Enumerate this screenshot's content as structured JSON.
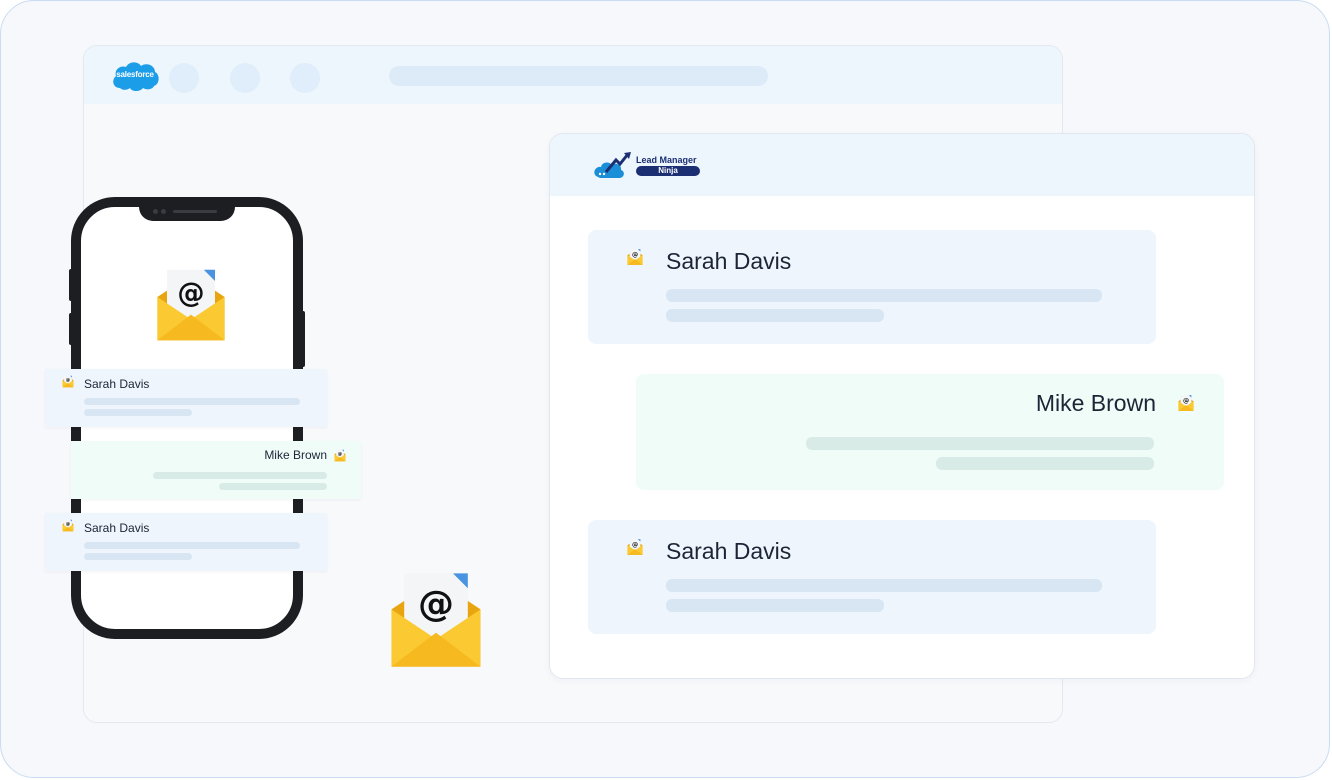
{
  "salesforce": {
    "logo_text": "salesforce",
    "brand_color": "#1c9de8"
  },
  "lead_manager": {
    "logo_line1": "Lead Manager",
    "logo_line2": "Ninja",
    "brand_color": "#1c2f73"
  },
  "desktop_messages": [
    {
      "name": "Sarah Davis",
      "style": "incoming"
    },
    {
      "name": "Mike Brown",
      "style": "outgoing"
    },
    {
      "name": "Sarah Davis",
      "style": "incoming"
    }
  ],
  "phone_messages": [
    {
      "name": "Sarah Davis",
      "style": "incoming"
    },
    {
      "name": "Mike Brown",
      "style": "outgoing"
    },
    {
      "name": "Sarah Davis",
      "style": "incoming"
    }
  ],
  "icons": {
    "email": "email-envelope-icon"
  },
  "colors": {
    "incoming_bg": "#eef5fd",
    "outgoing_bg": "#effcf8",
    "envelope": "#f9c531"
  }
}
